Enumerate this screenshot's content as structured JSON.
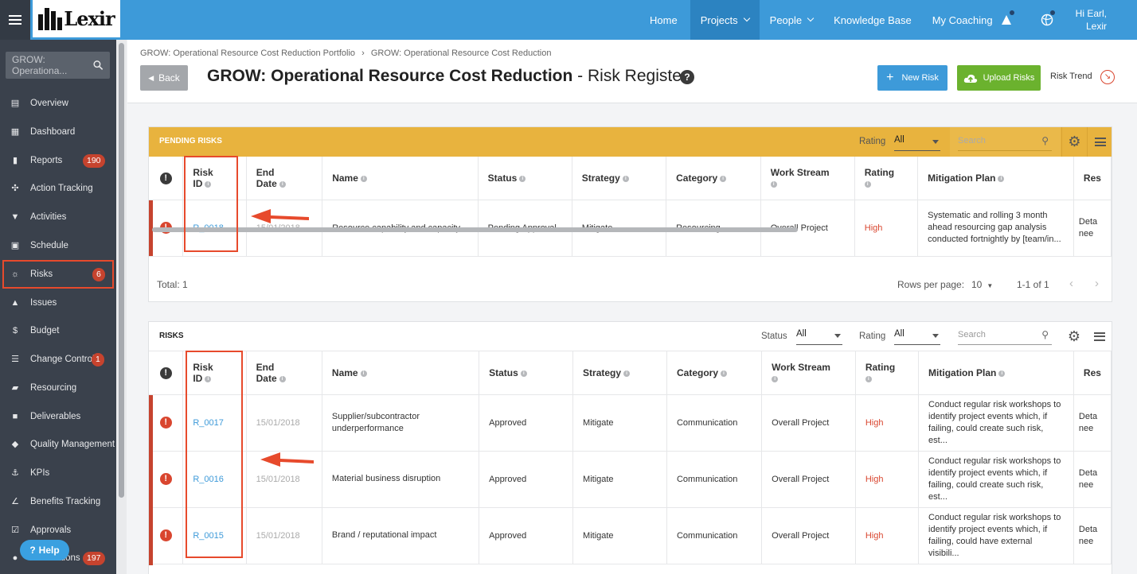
{
  "app": {
    "brand": "Lexir"
  },
  "nav": {
    "items": [
      "Home",
      "Projects",
      "People",
      "Knowledge Base",
      "My Coaching"
    ],
    "greeting_line1": "Hi Earl,",
    "greeting_line2": "Lexir"
  },
  "sidebar": {
    "search_placeholder": "GROW: Operationa...",
    "items": [
      {
        "label": "Overview",
        "icon": "overview-icon"
      },
      {
        "label": "Dashboard",
        "icon": "dashboard-icon"
      },
      {
        "label": "Reports",
        "icon": "reports-icon",
        "badge": "190"
      },
      {
        "label": "Action Tracking",
        "icon": "action-icon"
      },
      {
        "label": "Activities",
        "icon": "bookmark-icon"
      },
      {
        "label": "Schedule",
        "icon": "calendar-icon"
      },
      {
        "label": "Risks",
        "icon": "bulb-icon",
        "badge": "6"
      },
      {
        "label": "Issues",
        "icon": "warning-icon"
      },
      {
        "label": "Budget",
        "icon": "dollar-icon"
      },
      {
        "label": "Change Control",
        "icon": "change-icon",
        "badge": "1"
      },
      {
        "label": "Resourcing",
        "icon": "folder-icon"
      },
      {
        "label": "Deliverables",
        "icon": "truck-icon"
      },
      {
        "label": "Quality Management",
        "icon": "tag-icon"
      },
      {
        "label": "KPIs",
        "icon": "anchor-icon"
      },
      {
        "label": "Benefits Tracking",
        "icon": "chart-icon"
      },
      {
        "label": "Approvals",
        "icon": "check-icon"
      },
      {
        "label": "Notifications",
        "icon": "bell-icon",
        "badge": "197"
      }
    ],
    "help_label": "Help"
  },
  "header": {
    "breadcrumb_1": "GROW: Operational Resource Cost Reduction Portfolio",
    "breadcrumb_sep": "›",
    "breadcrumb_2": "GROW: Operational Resource Cost Reduction",
    "back_label": "Back",
    "title_bold": "GROW: Operational Resource Cost Reduction",
    "title_rest": " - Risk Register",
    "new_risk_label": "New Risk",
    "upload_label": "Upload Risks",
    "risk_trend_label": "Risk Trend"
  },
  "columns": [
    {
      "l1": "Risk",
      "l2": "ID"
    },
    {
      "l1": "End",
      "l2": "Date"
    },
    {
      "l1": "Name",
      "l2": ""
    },
    {
      "l1": "Status",
      "l2": ""
    },
    {
      "l1": "Strategy",
      "l2": ""
    },
    {
      "l1": "Category",
      "l2": ""
    },
    {
      "l1": "Work Stream",
      "l2": ""
    },
    {
      "l1": "Rating",
      "l2": ""
    },
    {
      "l1": "Mitigation Plan",
      "l2": ""
    },
    {
      "l1": "Res",
      "l2": ""
    }
  ],
  "pending": {
    "title": "PENDING RISKS",
    "rating_label": "Rating",
    "rating_value": "All",
    "search_placeholder": "Search",
    "rows": [
      {
        "id": "R_0018",
        "end_date": "15/01/2018",
        "name": "Resource capability and capacity",
        "status": "Pending Approval",
        "strategy": "Mitigate",
        "category": "Resourcing",
        "work_stream": "Overall Project",
        "rating": "High",
        "mitigation_1": "Systematic and rolling 3 month",
        "mitigation_2": "ahead resourcing gap analysis",
        "mitigation_3": "conducted fortnightly by [team/in...",
        "res_1": "Deta",
        "res_2": "nee"
      }
    ],
    "total": "Total: 1",
    "rows_per_page_label": "Rows per page:",
    "rows_per_page": "10",
    "range": "1-1 of 1"
  },
  "risks": {
    "title": "RISKS",
    "status_label": "Status",
    "status_value": "All",
    "rating_label": "Rating",
    "rating_value": "All",
    "search_placeholder": "Search",
    "rows": [
      {
        "id": "R_0017",
        "end_date": "15/01/2018",
        "name_1": "Supplier/subcontractor",
        "name_2": "underperformance",
        "status": "Approved",
        "strategy": "Mitigate",
        "category": "Communication",
        "work_stream": "Overall Project",
        "rating": "High",
        "mitigation_1": "Conduct regular risk workshops to",
        "mitigation_2": "identify project events which, if",
        "mitigation_3": "failing, could create such risk, est...",
        "res_1": "Deta",
        "res_2": "nee"
      },
      {
        "id": "R_0016",
        "end_date": "15/01/2018",
        "name_1": "Material business disruption",
        "name_2": "",
        "status": "Approved",
        "strategy": "Mitigate",
        "category": "Communication",
        "work_stream": "Overall Project",
        "rating": "High",
        "mitigation_1": "Conduct regular risk workshops to",
        "mitigation_2": "identify project events which, if",
        "mitigation_3": "failing, could create such risk, est...",
        "res_1": "Deta",
        "res_2": "nee"
      },
      {
        "id": "R_0015",
        "end_date": "15/01/2018",
        "name_1": "Brand / reputational impact",
        "name_2": "",
        "status": "Approved",
        "strategy": "Mitigate",
        "category": "Communication",
        "work_stream": "Overall Project",
        "rating": "High",
        "mitigation_1": "Conduct regular risk workshops to",
        "mitigation_2": "identify project events which, if",
        "mitigation_3": "failing, could have external visibili...",
        "res_1": "Deta",
        "res_2": "nee"
      }
    ]
  },
  "colors": {
    "topbar": "#3d9ad9",
    "sidebar": "#3a414c",
    "pending_header": "#e8b33e",
    "accent_red": "#d9462f",
    "upload_green": "#6bb22e"
  }
}
